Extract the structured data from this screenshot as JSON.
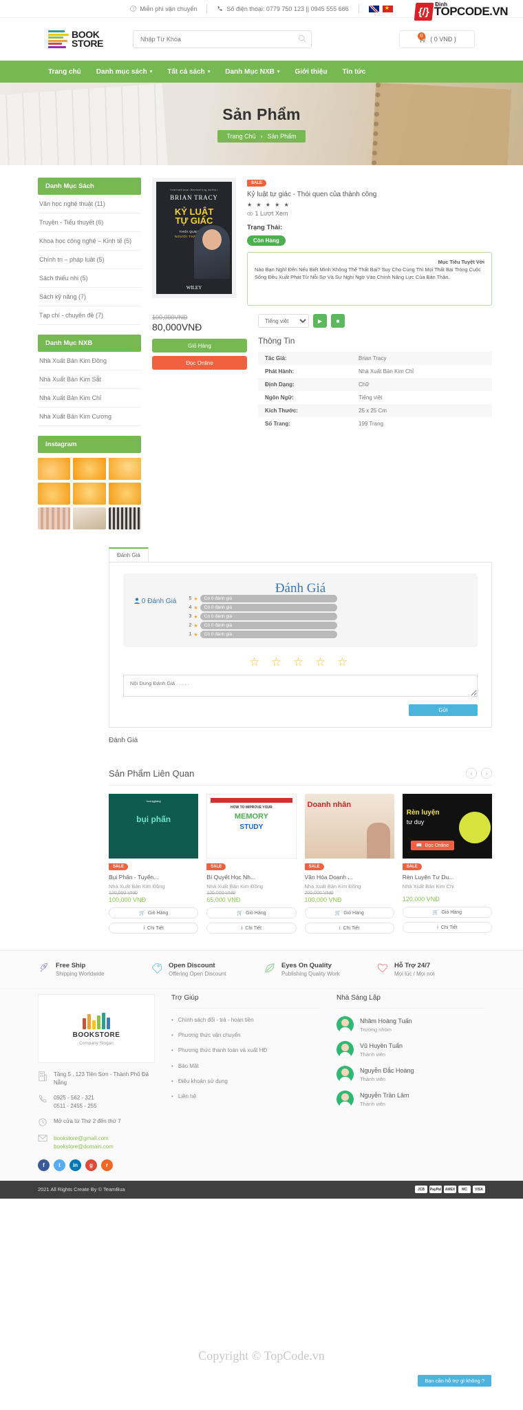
{
  "topbar": {
    "shipping": "Miễn phí vận chuyển",
    "phone": "Số điện thoại: 0779 750 123 || 0945 555 666",
    "flags": [
      "flag-uk-icon",
      "flag-vn-icon"
    ]
  },
  "header": {
    "logo_line1": "BOOK",
    "logo_line2": "STORE",
    "search_placeholder": "Nhập Từ Khóa",
    "search_value": "",
    "cart_label": "( 0 VNĐ )",
    "cart_count": "0"
  },
  "nav": {
    "items": [
      {
        "label": "Trang chủ",
        "caret": false
      },
      {
        "label": "Danh mục sách",
        "caret": true
      },
      {
        "label": "Tất cả sách",
        "caret": true
      },
      {
        "label": "Danh Mục NXB",
        "caret": true
      },
      {
        "label": "Giới thiệu",
        "caret": false
      },
      {
        "label": "Tin tức",
        "caret": false
      }
    ]
  },
  "banner": {
    "title": "Sản Phẩm",
    "crumb_home": "Trang Chủ",
    "crumb_sep": "›",
    "crumb_current": "Sản Phẩm"
  },
  "sidebar": {
    "books_head": "Danh Mục Sách",
    "books": [
      "Văn học nghệ thuật (11)",
      "Truyện - Tiểu thuyết (6)",
      "Khoa học công nghệ – Kinh tế (5)",
      "Chính trị – pháp luật (5)",
      "Sách thiếu nhi (5)",
      "Sách kỹ năng (7)",
      "Tạp chí - chuyên đề (7)"
    ],
    "nxb_head": "Danh Mục NXB",
    "nxb": [
      "Nhà Xuất Bản Kim Đồng",
      "Nhà Xuất Bản Kim Sắt",
      "Nhà Xuất Bản Kim Chỉ",
      "Nhà Xuất Bản Kim Cương"
    ],
    "instagram_head": "Instagram"
  },
  "product": {
    "sale_badge": "SALE",
    "title": "Kỷ luật tự giác - Thói quen của thành công",
    "stars": "★ ★ ★ ★ ★",
    "views": "1 Lượt Xem",
    "status_label": "Trạng Thái:",
    "status_value": "Còn Hàng",
    "desc_heading": "Mục Tiêu Tuyệt Vời",
    "desc_body": "Nào Bạn Nghĩ Đến Nếu Biết Mình Không Thể Thất Bại? Suy Cho Cùng Thì Mọi Thất Bại Trong Cuộc Sống Đều Xuất Phát Từ Nỗi Sợ Và Sự Nghi Ngờ Vào Chính Năng Lực Của Bản Thân.",
    "old_price": "100,000VNĐ",
    "new_price": "80,000VNĐ",
    "btn_cart": "Giỏ Hàng",
    "btn_read": "Đọc Online",
    "tts_language": "Tiếng việt",
    "tts_play": "play-icon",
    "tts_stop": "stop-icon",
    "info_heading": "Thông Tin",
    "info_rows": [
      {
        "k": "Tác Giả:",
        "v": "Brian Tracy"
      },
      {
        "k": "Phát Hành:",
        "v": "Nhà Xuất Bản Kim Chỉ"
      },
      {
        "k": "Định Dạng:",
        "v": "Chữ"
      },
      {
        "k": "Ngôn Ngữ:",
        "v": "Tiếng việt"
      },
      {
        "k": "Kích Thước:",
        "v": "25 x 25 Cm"
      },
      {
        "k": "Số Trang:",
        "v": "199 Trang"
      }
    ],
    "cover": {
      "tagline": "International Bestselling Author",
      "author": "BRIAN TRACY",
      "t1": "KỶ LUẬT",
      "t2": "TỰ GIÁC",
      "s1": "THÓI QUEN CỦA",
      "s2": "NGƯỜI THÀNH CÔNG",
      "publisher": "WILEY"
    }
  },
  "reviews": {
    "tab_label": "Đánh Giá",
    "title": "Đánh Giá",
    "count_label": "0 Đánh Giá",
    "bars": [
      {
        "n": "5",
        "text": "Có 0 đánh giá"
      },
      {
        "n": "4",
        "text": "Có 0 đánh giá"
      },
      {
        "n": "3",
        "text": "Có 0 đánh giá"
      },
      {
        "n": "2",
        "text": "Có 0 đánh giá"
      },
      {
        "n": "1",
        "text": "Có 0 đánh giá"
      }
    ],
    "stars": "☆ ☆ ☆ ☆ ☆",
    "input_placeholder": "Nội Dung Đánh Giá . . . . .",
    "submit": "Gửi",
    "footer_label": "Đánh Giá"
  },
  "related": {
    "heading": "Sản Phẩm Liên Quan",
    "prev": "‹",
    "next": "›",
    "overlay_btn": "Đọc Online",
    "cart_label": "Giỏ Hàng",
    "detail_label": "Chi Tiết",
    "items": [
      {
        "sale": "SALE",
        "name": "Bụi Phấn - Tuyển...",
        "pub": "Nhà Xuất Bản Kim Đồng",
        "old": "120,000 VNĐ",
        "new": "100,000 VNĐ"
      },
      {
        "sale": "SALE",
        "name": "Bí Quyết Học Nh...",
        "pub": "Nhà Xuất Bản Kim Đồng",
        "old": "120,000 VNĐ",
        "new": "65,000 VNĐ"
      },
      {
        "sale": "SALE",
        "name": "Văn Hóa Doanh ...",
        "pub": "Nhà Xuất Bản Kim Đồng",
        "old": "200,000 VNĐ",
        "new": "100,000 VNĐ"
      },
      {
        "sale": "SALE",
        "name": "Rèn Luyện Tư Du...",
        "pub": "Nhà Xuất Bản Kim Chỉ",
        "old": "",
        "new": "120,000 VNĐ"
      }
    ]
  },
  "features": [
    {
      "icon": "rocket-icon",
      "title": "Free Ship",
      "sub": "Shipping Worldwide"
    },
    {
      "icon": "tag-icon",
      "title": "Open Discount",
      "sub": "Offering Open Discount"
    },
    {
      "icon": "leaf-icon",
      "title": "Eyes On Quality",
      "sub": "Publishing Quality Work"
    },
    {
      "icon": "heart-icon",
      "title": "Hỗ Trợ 24/7",
      "sub": "Mọi lúc / Mọi nơi"
    }
  ],
  "footer": {
    "card_name": "BOOKSTORE",
    "card_slogan": "Company Slogan",
    "address": "Tầng 5 , 123 Tiên Sơn - Thành Phố Đà Nẵng",
    "phone1": "0925 - 562 - 321",
    "phone2": "0511 - 2455 - 255",
    "hours": "Mở cửa từ Thứ 2 đến thứ 7",
    "email1": "bookstore@gmail.com",
    "email2": "bookstore@domain.com",
    "socials": [
      "f",
      "t",
      "in",
      "g",
      "r"
    ],
    "help_head": "Trợ Giúp",
    "help_items": [
      "Chính sách đổi - trả - hoàn tiền",
      "Phương thức vận chuyển",
      "Phương thức thanh toán và xuất HĐ",
      "Bảo Mật",
      "Điều khoản sử dụng",
      "Liên hệ"
    ],
    "founders_head": "Nhà Sáng Lập",
    "founders": [
      {
        "name": "Nhâm Hoàng Tuấn",
        "role": "Trưởng nhóm"
      },
      {
        "name": "Vũ Huyền Tuấn",
        "role": "Thành viên"
      },
      {
        "name": "Nguyễn Đắc Hoàng",
        "role": "Thành viên"
      },
      {
        "name": "Nguyễn Trần Lâm",
        "role": "Thành viên"
      }
    ],
    "copyright": "2021 All Rights Create By © TeamBua",
    "payments": [
      "JCB",
      "PayPal",
      "AMEX",
      "MC",
      "VISA"
    ]
  },
  "chat": {
    "label": "Bạn cần hỗ trợ gì không ?"
  },
  "watermark": {
    "sub": "Đinh",
    "mark": "{/}",
    "brand": "TOPCODE.VN",
    "center": "Copyright © TopCode.vn"
  },
  "colors": {
    "green": "#76b852",
    "orange": "#f2613f",
    "blue": "#4ab4dd"
  }
}
